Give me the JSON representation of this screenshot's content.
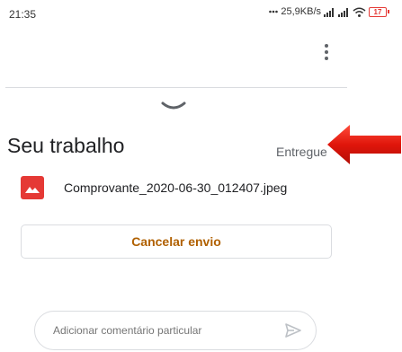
{
  "status_bar": {
    "time": "21:35",
    "network_speed": "25,9KB/s",
    "battery_level": "17",
    "battery_color": "#e53935",
    "icons": [
      "dots-icon",
      "signal-icon",
      "signal-icon",
      "wifi-icon",
      "battery-icon"
    ]
  },
  "toolbar": {
    "more_icon": "more-vert-icon"
  },
  "sheet": {
    "handle_icon": "chevron-down-icon",
    "title": "Seu trabalho",
    "status": "Entregue",
    "annotation_icon": "red-arrow-icon",
    "attachment": {
      "icon": "image-file-icon",
      "icon_color": "#e53935",
      "filename": "Comprovante_2020-06-30_012407.jpeg"
    },
    "cancel_label": "Cancelar envio",
    "cancel_color": "#b06000"
  },
  "comment": {
    "placeholder": "Adicionar comentário particular",
    "value": "",
    "send_icon": "send-icon"
  }
}
